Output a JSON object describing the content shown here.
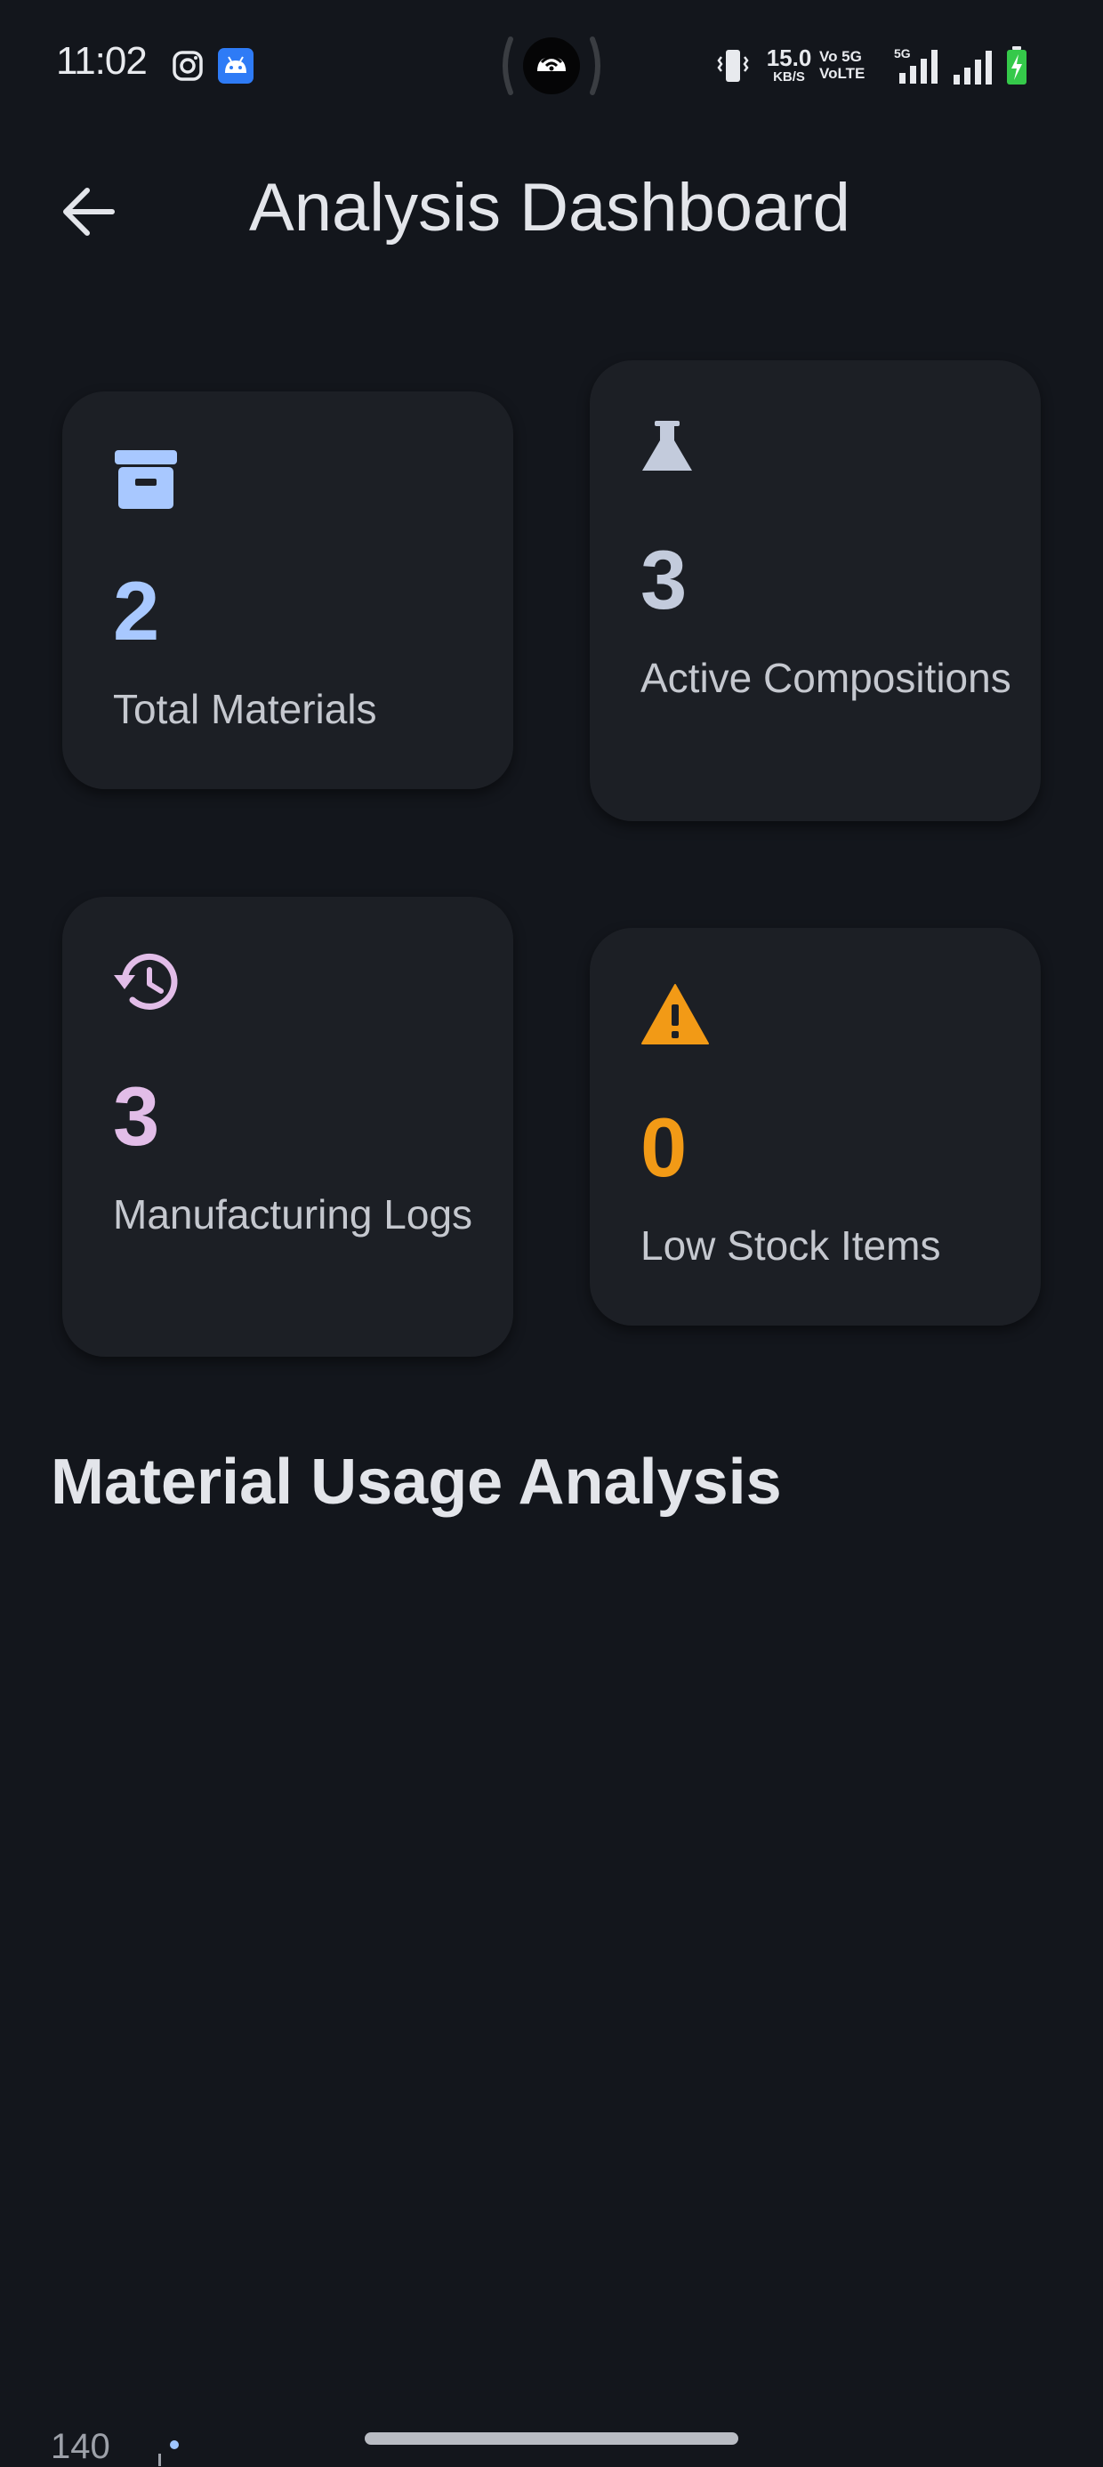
{
  "status_bar": {
    "time": "11:02",
    "net_speed_value": "15.0",
    "net_speed_unit": "KB/S",
    "volte_line1": "Vo 5G",
    "volte_line2": "VoLTE",
    "icons": [
      "instagram-icon",
      "android-icon",
      "hotspot-icon",
      "vibrate-icon",
      "signal-5g-icon",
      "signal-icon",
      "battery-charging-icon"
    ]
  },
  "app_bar": {
    "title": "Analysis Dashboard",
    "back_icon": "arrow-back-icon"
  },
  "stats": {
    "total_materials": {
      "value": "2",
      "label": "Total Materials",
      "icon": "archive-icon",
      "color": "#a8c8ff"
    },
    "active_compositions": {
      "value": "3",
      "label": "Active Compositions",
      "icon": "flask-icon",
      "color": "#c3cbdc"
    },
    "manufacturing_logs": {
      "value": "3",
      "label": "Manufacturing Logs",
      "icon": "history-icon",
      "color": "#e2bde8"
    },
    "low_stock_items": {
      "value": "0",
      "label": "Low Stock Items",
      "icon": "warning-icon",
      "color": "#f29a16"
    }
  },
  "section": {
    "title": "Material Usage Analysis"
  },
  "chart_data": {
    "type": "scatter",
    "y_tick_labels": [
      "140"
    ]
  },
  "colors": {
    "background": "#13161c",
    "card": "#1c1f25"
  }
}
